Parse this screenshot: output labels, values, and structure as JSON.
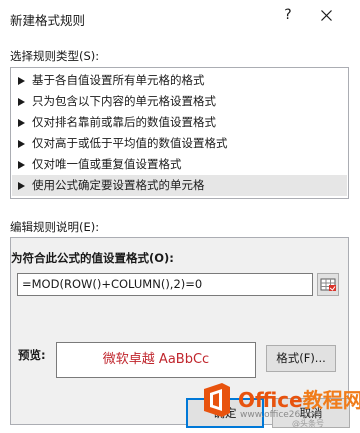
{
  "window": {
    "title": "新建格式规则",
    "help_label": "?"
  },
  "rule_type": {
    "label": "选择规则类型(S):",
    "items": [
      "基于各自值设置所有单元格的格式",
      "只为包含以下内容的单元格设置格式",
      "仅对排名靠前或靠后的数值设置格式",
      "仅对高于或低于平均值的数值设置格式",
      "仅对唯一值或重复值设置格式",
      "使用公式确定要设置格式的单元格"
    ],
    "selected_index": 5
  },
  "description": {
    "label": "编辑规则说明(E):",
    "formula_label": "为符合此公式的值设置格式(O):",
    "formula_value": "=MOD(ROW()+COLUMN(),2)=0",
    "preview_label": "预览:",
    "preview_text": "微软卓越  AaBbCc",
    "preview_color": "#c0262d",
    "format_button": "格式(F)..."
  },
  "buttons": {
    "ok": "确定",
    "cancel": "取消"
  },
  "watermark": {
    "brand": "Office",
    "brand_cn": "教程网",
    "site": "www.office26.com",
    "handle": "@头条号"
  },
  "colors": {
    "accent": "#0078d7",
    "brand_orange": "#e8530e"
  }
}
